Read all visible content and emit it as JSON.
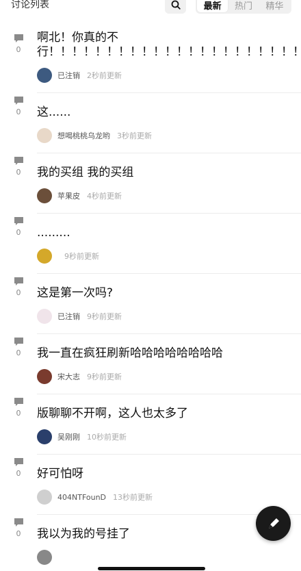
{
  "header": {
    "title": "讨论列表",
    "tabs": [
      {
        "label": "最新",
        "active": true
      },
      {
        "label": "热门",
        "active": false
      },
      {
        "label": "精华",
        "active": false
      }
    ]
  },
  "posts": [
    {
      "text": "啊北！你真的不行！！！！！！！！！！！！！！！！！！！！！！！！！！！！！！！！！！！！！！！！",
      "count": "0",
      "author": "已注销",
      "time": "2秒前更新",
      "avatar_color": "#3d5a80"
    },
    {
      "text": "这......",
      "count": "0",
      "author": "想喝桃桃乌龙哟",
      "time": "3秒前更新",
      "avatar_color": "#e8d8c8"
    },
    {
      "text": "我的买组 我的买组",
      "count": "0",
      "author": "苹果皮",
      "time": "4秒前更新",
      "avatar_color": "#6b4f3a"
    },
    {
      "text": ".........",
      "count": "0",
      "author": "",
      "time": "9秒前更新",
      "avatar_color": "#d4a82a"
    },
    {
      "text": "这是第一次吗?",
      "count": "0",
      "author": "已注销",
      "time": "9秒前更新",
      "avatar_color": "#f0e4ea"
    },
    {
      "text": "我一直在疯狂刷新哈哈哈哈哈哈哈哈",
      "count": "0",
      "author": "宋大志",
      "time": "9秒前更新",
      "avatar_color": "#7a3b2e"
    },
    {
      "text": "版聊聊不开啊，这人也太多了",
      "count": "0",
      "author": "吴刚刚",
      "time": "10秒前更新",
      "avatar_color": "#2a3f6b"
    },
    {
      "text": "好可怕呀",
      "count": "0",
      "author": "404NTFounD",
      "time": "13秒前更新",
      "avatar_color": "#cfcfcf"
    },
    {
      "text": "我以为我的号挂了",
      "count": "0",
      "author": "",
      "time": "",
      "avatar_color": "#888888"
    }
  ],
  "icons": {
    "search": "search-icon",
    "comment": "comment-bubble-icon",
    "compose": "pen-icon"
  }
}
